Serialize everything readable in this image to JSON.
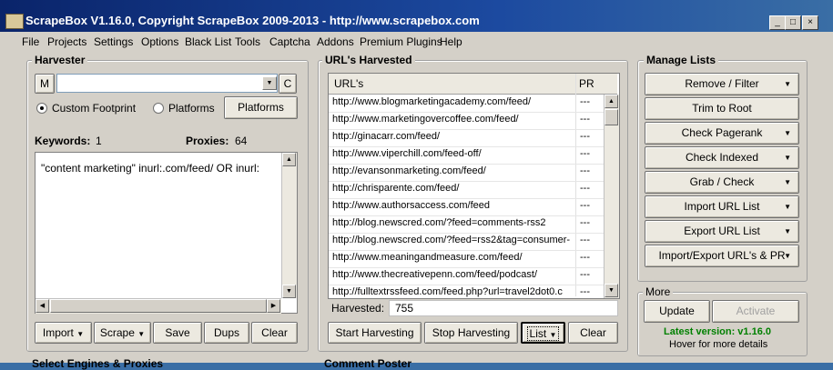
{
  "window": {
    "title": "ScrapeBox V1.16.0, Copyright ScrapeBox 2009-2013 - http://www.scrapebox.com",
    "min": "_",
    "max": "□",
    "close": "×"
  },
  "menu": [
    "File",
    "Projects",
    "Settings",
    "Options",
    "Black List",
    "Tools",
    "Captcha",
    "Addons",
    "Premium Plugins",
    "Help"
  ],
  "harvester": {
    "title": "Harvester",
    "m_label": "M",
    "c_label": "C",
    "footprint_value": "",
    "radio_custom": "Custom Footprint",
    "radio_platforms": "Platforms",
    "platforms_button": "Platforms",
    "keywords_label": "Keywords:",
    "keywords_count": "1",
    "proxies_label": "Proxies:",
    "proxies_count": "64",
    "keywords_text": "\"content marketing\" inurl:.com/feed/ OR inurl:",
    "buttons": {
      "import": "Import",
      "scrape": "Scrape",
      "save": "Save",
      "dups": "Dups",
      "clear": "Clear"
    }
  },
  "urls": {
    "title": "URL's Harvested",
    "col_url": "URL's",
    "col_pr": "PR",
    "rows": [
      {
        "url": "http://www.blogmarketingacademy.com/feed/",
        "pr": "---"
      },
      {
        "url": "http://www.marketingovercoffee.com/feed/",
        "pr": "---"
      },
      {
        "url": "http://ginacarr.com/feed/",
        "pr": "---"
      },
      {
        "url": "http://www.viperchill.com/feed-off/",
        "pr": "---"
      },
      {
        "url": "http://evansonmarketing.com/feed/",
        "pr": "---"
      },
      {
        "url": "http://chrisparente.com/feed/",
        "pr": "---"
      },
      {
        "url": "http://www.authorsaccess.com/feed",
        "pr": "---"
      },
      {
        "url": "http://blog.newscred.com/?feed=comments-rss2",
        "pr": "---"
      },
      {
        "url": "http://blog.newscred.com/?feed=rss2&tag=consumer-",
        "pr": "---"
      },
      {
        "url": "http://www.meaningandmeasure.com/feed/",
        "pr": "---"
      },
      {
        "url": "http://www.thecreativepenn.com/feed/podcast/",
        "pr": "---"
      },
      {
        "url": "http://fulltextrssfeed.com/feed.php?url=travel2dot0.c",
        "pr": "---"
      }
    ],
    "harvested_label": "Harvested:",
    "harvested_count": "755",
    "buttons": {
      "start": "Start Harvesting",
      "stop": "Stop Harvesting",
      "list": "List",
      "clear": "Clear"
    }
  },
  "manage": {
    "title": "Manage Lists",
    "buttons": [
      {
        "label": "Remove / Filter",
        "dropdown": true
      },
      {
        "label": "Trim to Root",
        "dropdown": false
      },
      {
        "label": "Check Pagerank",
        "dropdown": true
      },
      {
        "label": "Check Indexed",
        "dropdown": true
      },
      {
        "label": "Grab / Check",
        "dropdown": true
      },
      {
        "label": "Import URL List",
        "dropdown": true
      },
      {
        "label": "Export URL List",
        "dropdown": true
      },
      {
        "label": "Import/Export URL's & PR",
        "dropdown": true
      }
    ]
  },
  "more": {
    "title": "More",
    "update": "Update",
    "activate": "Activate",
    "latest": "Latest version: v1.16.0",
    "hover": "Hover for more details",
    "latest_color": "#008000"
  },
  "bottom_cutoff": {
    "left": "Select Engines & Proxies",
    "mid": "Comment Poster"
  }
}
